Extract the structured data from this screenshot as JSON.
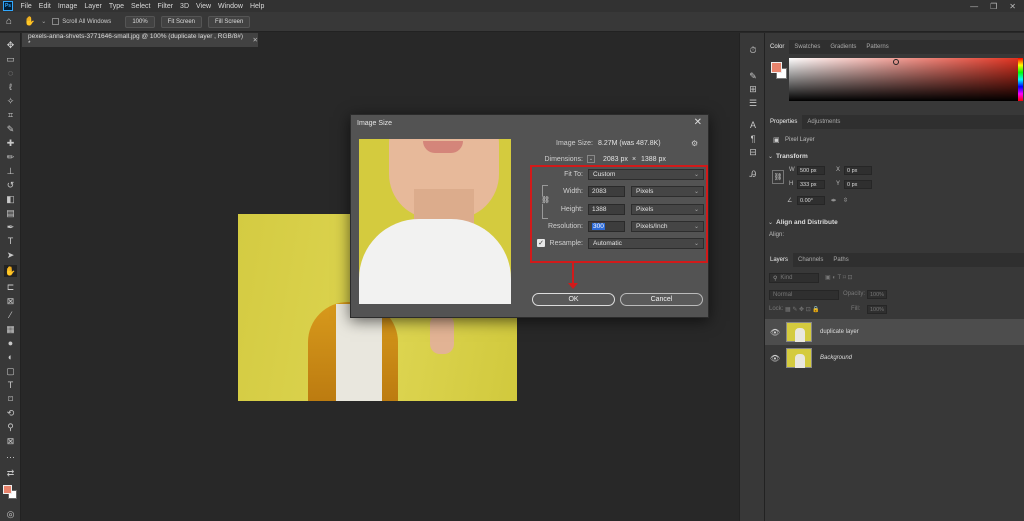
{
  "menu": [
    "File",
    "Edit",
    "Image",
    "Layer",
    "Type",
    "Select",
    "Filter",
    "3D",
    "View",
    "Window",
    "Help"
  ],
  "options": {
    "scroll_all_label": "Scroll All Windows",
    "zoom_label": "100%",
    "fit_screen_label": "Fit Screen",
    "fill_screen_label": "Fill Screen"
  },
  "document_tab": "pexels-anna-shvets-3771646-small.jpg @ 100% (duplicate layer , RGB/8#) *",
  "dialog": {
    "title": "Image Size",
    "image_size_label": "Image Size:",
    "image_size_value": "8.27M (was 487.8K)",
    "dimensions_label": "Dimensions:",
    "dimensions_w": "2083 px",
    "dimensions_x": "×",
    "dimensions_h": "1388 px",
    "fit_to_label": "Fit To:",
    "fit_to_value": "Custom",
    "width_label": "Width:",
    "width_value": "2083",
    "width_unit": "Pixels",
    "height_label": "Height:",
    "height_value": "1388",
    "height_unit": "Pixels",
    "resolution_label": "Resolution:",
    "resolution_value": "300",
    "resolution_unit": "Pixels/Inch",
    "resample_label": "Resample:",
    "resample_value": "Automatic",
    "ok_label": "OK",
    "cancel_label": "Cancel"
  },
  "panels": {
    "color_tabs": [
      "Color",
      "Swatches",
      "Gradients",
      "Patterns"
    ],
    "properties_tabs": [
      "Properties",
      "Adjustments"
    ],
    "pixel_layer_label": "Pixel Layer",
    "transform_title": "Transform",
    "w_label": "W",
    "w_value": "500 px",
    "h_label": "H",
    "h_value": "333 px",
    "x_label": "X",
    "x_value": "0 px",
    "y_label": "Y",
    "y_value": "0 px",
    "angle_value": "0.00°",
    "align_title": "Align and Distribute",
    "align_label": "Align:",
    "layers_tabs": [
      "Layers",
      "Channels",
      "Paths"
    ],
    "kind_label": "Kind",
    "blend_mode": "Normal",
    "opacity_label": "Opacity:",
    "opacity_value": "100%",
    "lock_label": "Lock:",
    "fill_label": "Fill:",
    "fill_value": "100%",
    "layers": [
      {
        "name": "duplicate layer"
      },
      {
        "name": "Background"
      }
    ]
  },
  "colors": {
    "foreground": "#e8836c",
    "background": "#ffffff",
    "annotation": "#d11a1a"
  }
}
